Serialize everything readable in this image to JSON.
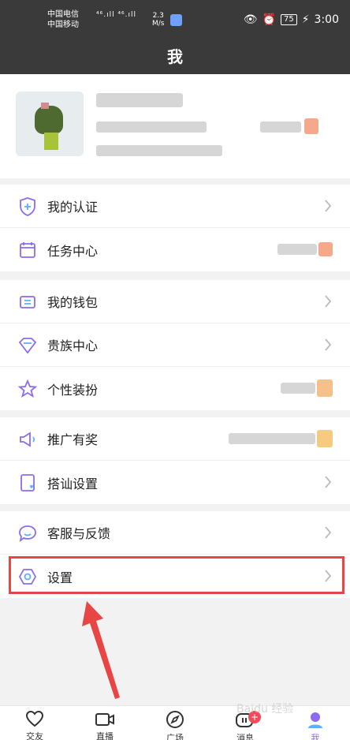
{
  "status_bar": {
    "carrier_1": "中国电信",
    "carrier_2": "中国移动",
    "network": "⁴⁶.ıll ⁴⁶.ıll",
    "speed": "2.3\nM/s",
    "battery": "75",
    "time": "3:00"
  },
  "header": {
    "title": "我"
  },
  "menu": {
    "group1": [
      {
        "label": "我的认证",
        "icon": "shield-plus-icon"
      },
      {
        "label": "任务中心",
        "icon": "calendar-icon"
      }
    ],
    "group2": [
      {
        "label": "我的钱包",
        "icon": "wallet-icon"
      },
      {
        "label": "贵族中心",
        "icon": "diamond-icon"
      },
      {
        "label": "个性装扮",
        "icon": "star-icon"
      }
    ],
    "group3": [
      {
        "label": "推广有奖",
        "icon": "megaphone-icon"
      },
      {
        "label": "搭讪设置",
        "icon": "heart-doc-icon"
      }
    ],
    "group4": [
      {
        "label": "客服与反馈",
        "icon": "chat-bubble-icon"
      },
      {
        "label": "设置",
        "icon": "hexagon-settings-icon"
      }
    ]
  },
  "tabbar": {
    "tabs": [
      {
        "label": "交友",
        "icon": "heart-icon"
      },
      {
        "label": "直播",
        "icon": "video-camera-icon"
      },
      {
        "label": "广场",
        "icon": "compass-icon"
      },
      {
        "label": "消息",
        "icon": "message-icon",
        "badge": "+"
      },
      {
        "label": "我",
        "icon": "profile-icon"
      }
    ]
  },
  "colors": {
    "accent": "#8b6cf0",
    "highlight_border": "#e84545",
    "arrow": "#e84545"
  },
  "watermark": "Baidu 经验"
}
